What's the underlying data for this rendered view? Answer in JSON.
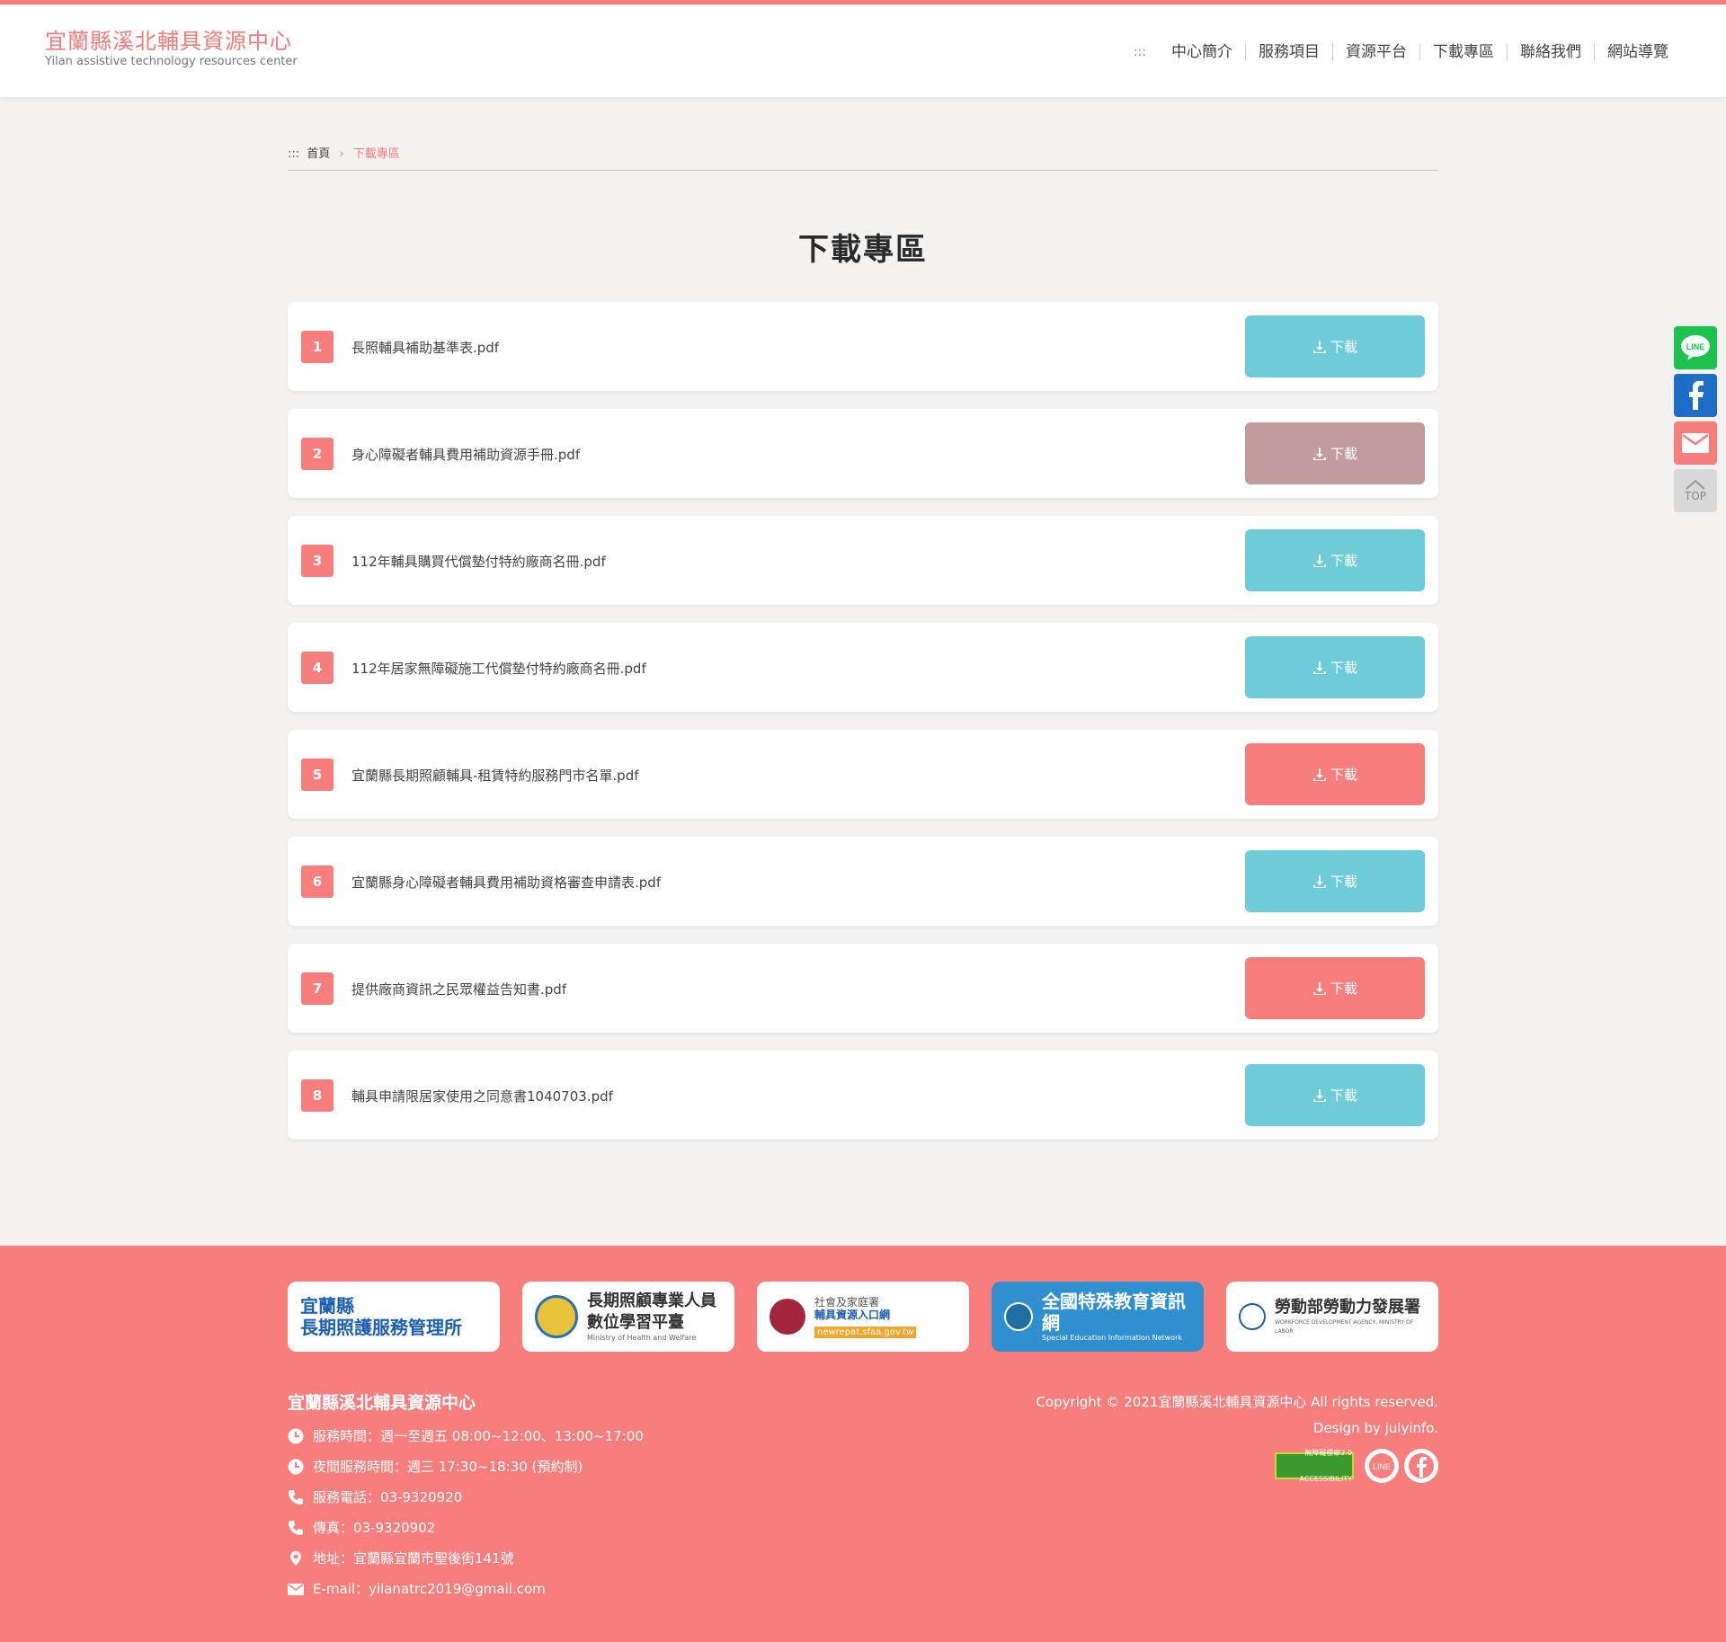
{
  "header": {
    "title": "宜蘭縣溪北輔具資源中心",
    "subtitle": "Yilan assistive technology resources center",
    "access_key": ":::",
    "nav": [
      {
        "label": "中心簡介"
      },
      {
        "label": "服務項目"
      },
      {
        "label": "資源平台"
      },
      {
        "label": "下載專區"
      },
      {
        "label": "聯絡我們"
      },
      {
        "label": "網站導覽"
      }
    ]
  },
  "breadcrumb": {
    "access_key": ":::",
    "home": "首頁",
    "separator": "›",
    "current": "下載專區"
  },
  "page_title": "下載專區",
  "downloads": [
    {
      "num": "1",
      "name": "長照輔具補助基準表.pdf",
      "button": "下載",
      "color": "#6ecbd8"
    },
    {
      "num": "2",
      "name": "身心障礙者輔具費用補助資源手冊.pdf",
      "button": "下載",
      "color": "#c29b9f"
    },
    {
      "num": "3",
      "name": "112年輔具購買代償墊付特約廠商名冊.pdf",
      "button": "下載",
      "color": "#6ecbd8"
    },
    {
      "num": "4",
      "name": "112年居家無障礙施工代償墊付特約廠商名冊.pdf",
      "button": "下載",
      "color": "#6ecbd8"
    },
    {
      "num": "5",
      "name": "宜蘭縣長期照顧輔具-租賃特約服務門市名單.pdf",
      "button": "下載",
      "color": "#f87e7e"
    },
    {
      "num": "6",
      "name": "宜蘭縣身心障礙者輔具費用補助資格審查申請表.pdf",
      "button": "下載",
      "color": "#6ecbd8"
    },
    {
      "num": "7",
      "name": "提供廠商資訊之民眾權益告知書.pdf",
      "button": "下載",
      "color": "#f87e7e"
    },
    {
      "num": "8",
      "name": "輔具申請限居家使用之同意書1040703.pdf",
      "button": "下載",
      "color": "#6ecbd8"
    }
  ],
  "side": {
    "top_label": "TOP",
    "line_label": "LINE"
  },
  "partners": {
    "p1_line1": "宜蘭縣",
    "p1_line2": "長期照護服務管理所",
    "p2_line1": "長期照顧專業人員",
    "p2_line2": "數位學習平臺",
    "p2_sub": "Ministry of Health and Welfare",
    "p3_small": "社會及家庭署",
    "p3_title": "輔具資源入口網",
    "p3_url": "newrepat.sfaa.gov.tw",
    "p4_title": "全國特殊教育資訊網",
    "p4_sub": "Special Education Information Network",
    "p5_title": "勞動部勞動力發展署",
    "p5_sub": "WORKFORCE DEVELOPMENT AGENCY, MINISTRY OF LABOR"
  },
  "footer": {
    "org": "宜蘭縣溪北輔具資源中心",
    "hours": "服務時間：週一至週五 08:00~12:00、13:00~17:00",
    "night_hours": "夜間服務時間：週三 17:30~18:30 (預約制)",
    "phone": "服務電話：03-9320920",
    "fax": "傳真：03-9320902",
    "address": "地址：宜蘭縣宜蘭市聖後街141號",
    "email": "E-mail：yilanatrc2019@gmail.com",
    "copyright": "Copyright © 2021宜蘭縣溪北輔具資源中心 All rights reserved.",
    "design": "Design by julyinfo.",
    "accessibility_badge": "無障礙標章2.0 ACCESSIBILITY",
    "line_icon_label": "LINE"
  },
  "colors": {
    "accent": "#f87e7e",
    "blue_button": "#6ecbd8",
    "mauve_button": "#c29b9f",
    "background": "#f3f2f1"
  }
}
